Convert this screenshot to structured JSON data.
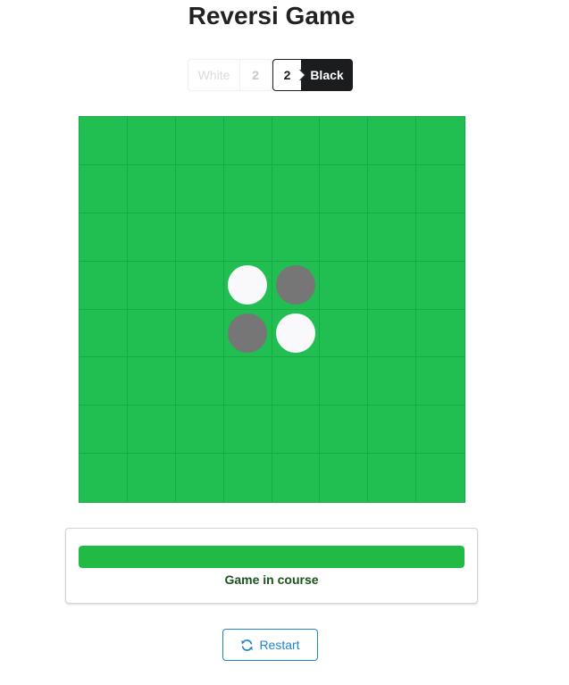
{
  "title": "Reversi Game",
  "score": {
    "white_label": "White",
    "white_count": "2",
    "black_count": "2",
    "black_label": "Black",
    "current_turn": "Black"
  },
  "board": {
    "rows": 8,
    "cols": 8,
    "discs": [
      {
        "row": 3,
        "col": 3,
        "color": "white"
      },
      {
        "row": 3,
        "col": 4,
        "color": "black"
      },
      {
        "row": 4,
        "col": 3,
        "color": "black"
      },
      {
        "row": 4,
        "col": 4,
        "color": "white"
      }
    ]
  },
  "status": {
    "progress_percent": 100,
    "label": "Game in course"
  },
  "restart": {
    "label": "Restart",
    "icon": "refresh-icon"
  },
  "colors": {
    "board": "#21be52",
    "white_disc": "#f9f9fb",
    "black_disc": "#767676",
    "progress": "#21ba45",
    "primary": "#2185d0"
  }
}
